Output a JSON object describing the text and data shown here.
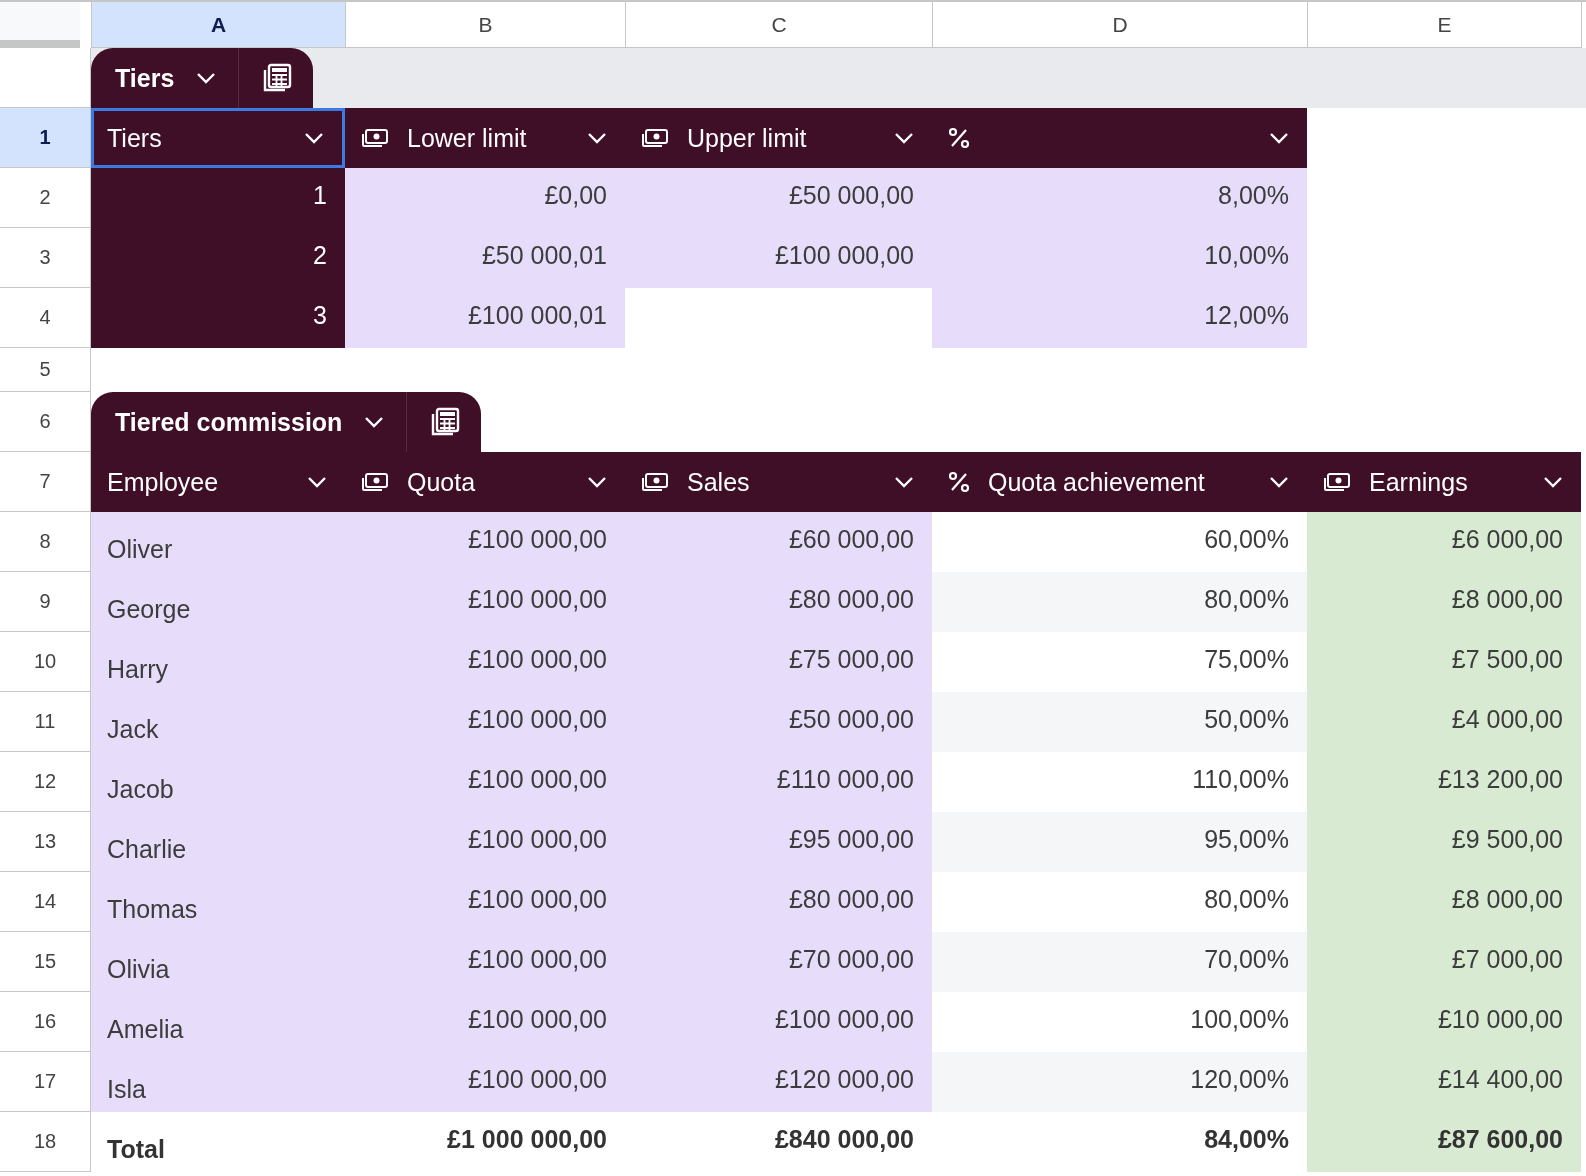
{
  "column_headers": [
    {
      "label": "A",
      "selected": true
    },
    {
      "label": "B",
      "selected": false
    },
    {
      "label": "C",
      "selected": false
    },
    {
      "label": "D",
      "selected": false
    },
    {
      "label": "E",
      "selected": false
    }
  ],
  "sections": [
    {
      "kind": "table",
      "name": "Tiers",
      "header": {
        "row_number": "1",
        "row_selected": true,
        "columns": [
          {
            "label": "Tiers",
            "kind": "index",
            "selected": true
          },
          {
            "label": "Lower limit",
            "kind": "amount",
            "selected": false
          },
          {
            "label": "Upper limit",
            "kind": "amount",
            "selected": false
          },
          {
            "kind": "rate",
            "selected": false
          }
        ]
      },
      "rows": [
        {
          "row_number": "2",
          "cells": [
            "1",
            "£0,00",
            "£50 000,00",
            "8,00%"
          ]
        },
        {
          "row_number": "3",
          "cells": [
            "2",
            "£50 000,01",
            "£100 000,00",
            "10,00%"
          ]
        },
        {
          "row_number": "4",
          "cells": [
            "3",
            "£100 000,01",
            null,
            "12,00%"
          ]
        }
      ]
    },
    {
      "kind": "blank",
      "row_number": "5"
    },
    {
      "kind": "table",
      "name": "Tiered commission",
      "tab_row_number": "6",
      "header": {
        "row_number": "7",
        "row_selected": false,
        "columns": [
          {
            "label": "Employee",
            "kind": "name",
            "selected": false
          },
          {
            "label": "Quota",
            "kind": "amount",
            "selected": false
          },
          {
            "label": "Sales",
            "kind": "amount",
            "selected": false
          },
          {
            "label": "Quota achievement",
            "kind": "ratio",
            "selected": false
          },
          {
            "label": "Earnings",
            "kind": "payout",
            "selected": false
          }
        ]
      },
      "rows": [
        {
          "row_number": "8",
          "cells": [
            "Oliver",
            "£100 000,00",
            "£60 000,00",
            "60,00%",
            "£6 000,00"
          ]
        },
        {
          "row_number": "9",
          "cells": [
            "George",
            "£100 000,00",
            "£80 000,00",
            "80,00%",
            "£8 000,00"
          ]
        },
        {
          "row_number": "10",
          "cells": [
            "Harry",
            "£100 000,00",
            "£75 000,00",
            "75,00%",
            "£7 500,00"
          ]
        },
        {
          "row_number": "11",
          "cells": [
            "Jack",
            "£100 000,00",
            "£50 000,00",
            "50,00%",
            "£4 000,00"
          ]
        },
        {
          "row_number": "12",
          "cells": [
            "Jacob",
            "£100 000,00",
            "£110 000,00",
            "110,00%",
            "£13 200,00"
          ]
        },
        {
          "row_number": "13",
          "cells": [
            "Charlie",
            "£100 000,00",
            "£95 000,00",
            "95,00%",
            "£9 500,00"
          ]
        },
        {
          "row_number": "14",
          "cells": [
            "Thomas",
            "£100 000,00",
            "£80 000,00",
            "80,00%",
            "£8 000,00"
          ]
        },
        {
          "row_number": "15",
          "cells": [
            "Olivia",
            "£100 000,00",
            "£70 000,00",
            "70,00%",
            "£7 000,00"
          ]
        },
        {
          "row_number": "16",
          "cells": [
            "Amelia",
            "£100 000,00",
            "£100 000,00",
            "100,00%",
            "£10 000,00"
          ]
        },
        {
          "row_number": "17",
          "cells": [
            "Isla",
            "£100 000,00",
            "£120 000,00",
            "120,00%",
            "£14 400,00"
          ]
        }
      ],
      "total": {
        "row_number": "18",
        "cells": [
          "Total",
          "£1 000 000,00",
          "£840 000,00",
          "84,00%",
          "£87 600,00"
        ]
      }
    }
  ]
}
